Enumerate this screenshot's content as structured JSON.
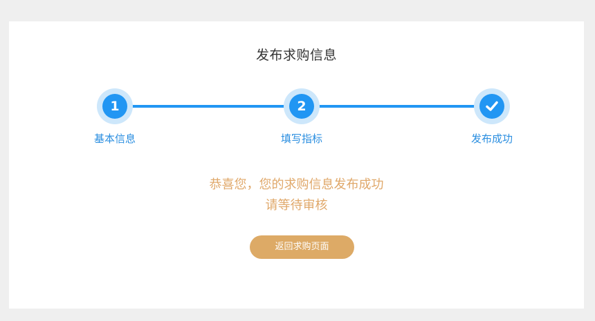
{
  "page": {
    "title": "发布求购信息"
  },
  "steps": [
    {
      "number": "1",
      "label": "基本信息",
      "icon": "number"
    },
    {
      "number": "2",
      "label": "填写指标",
      "icon": "number"
    },
    {
      "number": "",
      "label": "发布成功",
      "icon": "checkmark-icon"
    }
  ],
  "colors": {
    "step_primary": "#2196f3",
    "step_ring": "#cde7fb",
    "message": "#e0a86a",
    "button": "#ddaa66"
  },
  "message": {
    "line1": "恭喜您，您的求购信息发布成功",
    "line2": "请等待审核"
  },
  "actions": {
    "back_label": "返回求购页面"
  }
}
